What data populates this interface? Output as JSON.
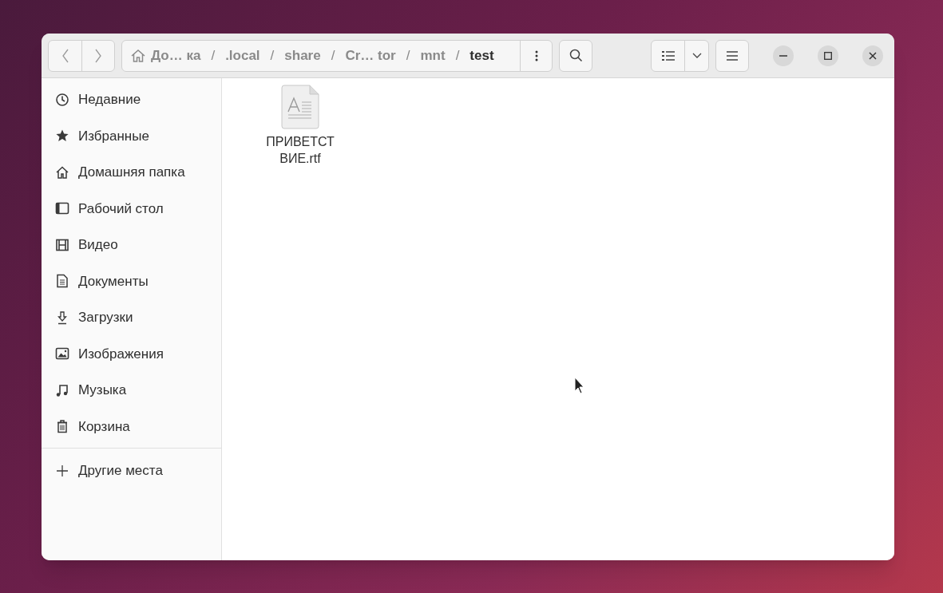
{
  "path_bar": [
    {
      "kind": "home",
      "label": "До… ка",
      "current": false
    },
    {
      "kind": "separator",
      "label": "/"
    },
    {
      "kind": "folder",
      "label": ".local",
      "current": false
    },
    {
      "kind": "separator",
      "label": "/"
    },
    {
      "kind": "folder",
      "label": "share",
      "current": false
    },
    {
      "kind": "separator",
      "label": "/"
    },
    {
      "kind": "folder",
      "label": "Cr… tor",
      "current": false
    },
    {
      "kind": "separator",
      "label": "/"
    },
    {
      "kind": "folder",
      "label": "mnt",
      "current": false
    },
    {
      "kind": "separator",
      "label": "/"
    },
    {
      "kind": "folder",
      "label": "test",
      "current": true
    }
  ],
  "sidebar": {
    "items": [
      {
        "kind": "recent",
        "label": "Недавние"
      },
      {
        "kind": "starred",
        "label": "Избранные"
      },
      {
        "kind": "home",
        "label": "Домашняя папка"
      },
      {
        "kind": "desktop",
        "label": "Рабочий стол"
      },
      {
        "kind": "video",
        "label": "Видео"
      },
      {
        "kind": "documents",
        "label": "Документы"
      },
      {
        "kind": "downloads",
        "label": "Загрузки"
      },
      {
        "kind": "pictures",
        "label": "Изображения"
      },
      {
        "kind": "music",
        "label": "Музыка"
      },
      {
        "kind": "trash",
        "label": "Корзина"
      }
    ],
    "other": {
      "kind": "other",
      "label": "Другие места"
    }
  },
  "files": [
    {
      "kind": "rtf",
      "name": "ПРИВЕТСТ ВИЕ.rtf"
    }
  ]
}
